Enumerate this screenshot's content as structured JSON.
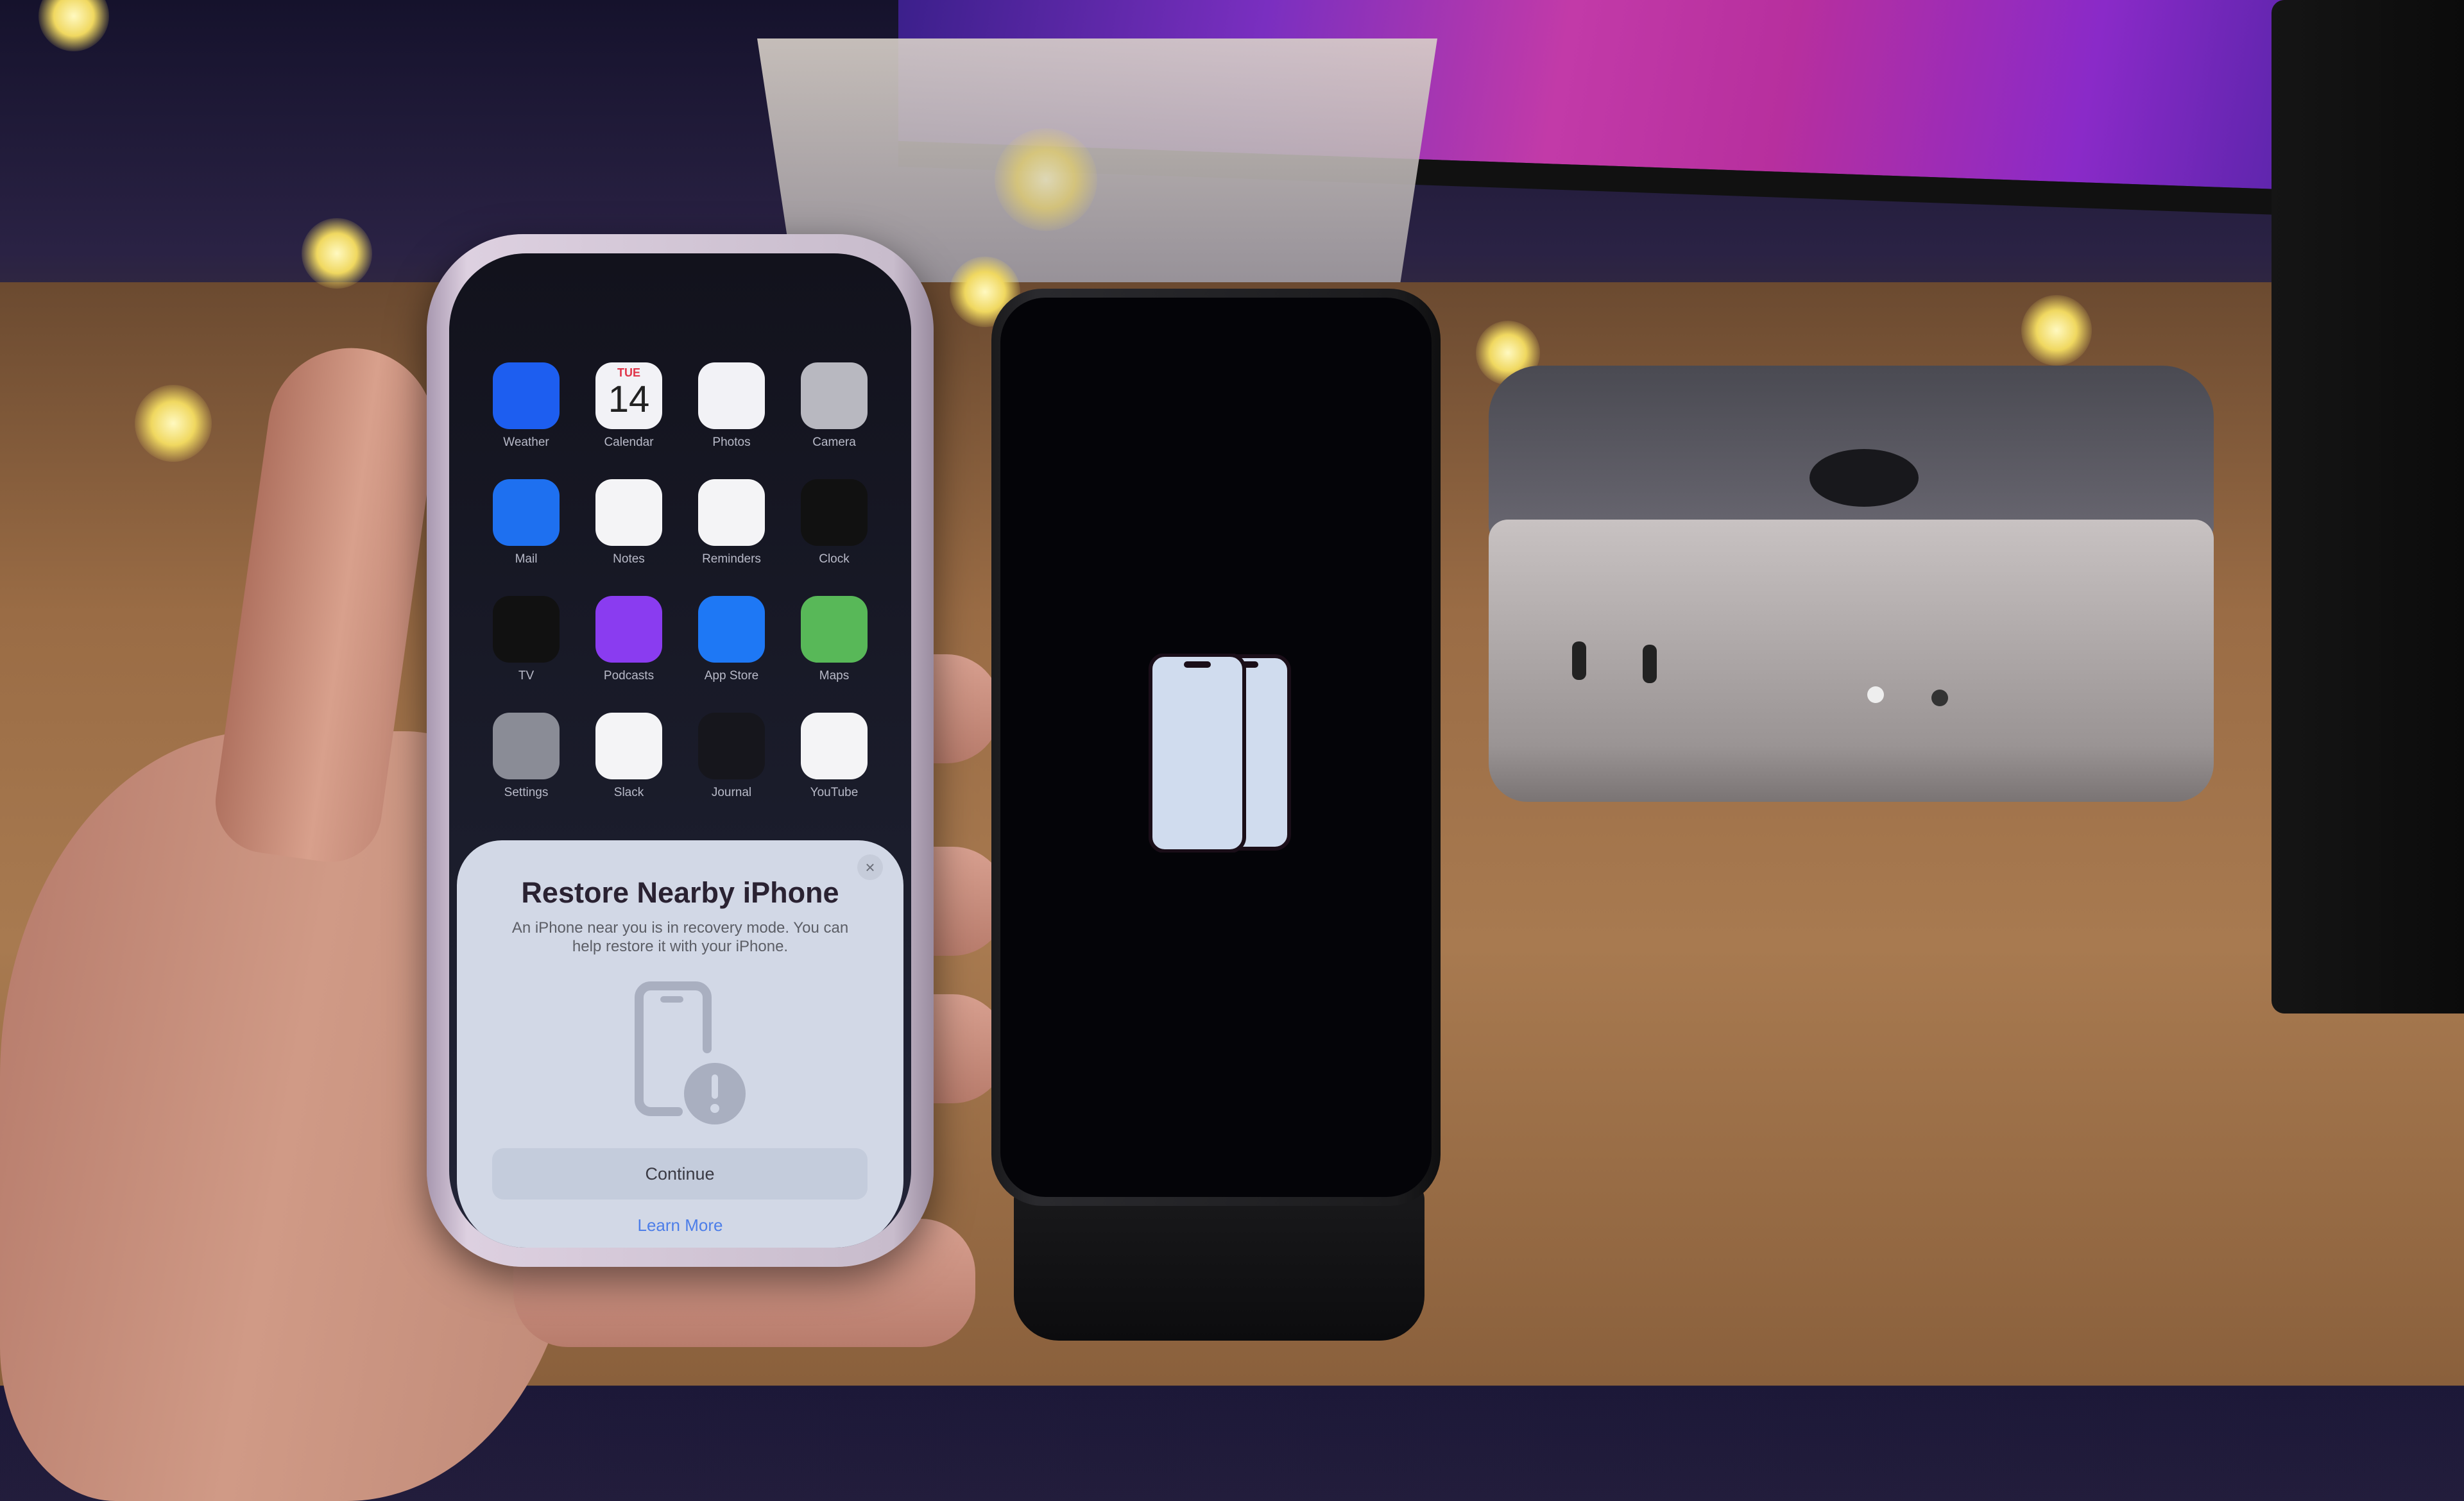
{
  "scene": {
    "description": "Two iPhones on desk; left iPhone shows Restore Nearby iPhone sheet, right iPhone shows recovery mode graphic"
  },
  "home_screen": {
    "apps": [
      {
        "label": "Weather",
        "icon": "weather-icon",
        "color": "#1d5ef0"
      },
      {
        "label": "Calendar",
        "icon": "calendar-icon",
        "color": "#f2f2f6",
        "day": "TUE",
        "date": "14"
      },
      {
        "label": "Photos",
        "icon": "photos-icon",
        "color": "#f2f2f6"
      },
      {
        "label": "Camera",
        "icon": "camera-icon",
        "color": "#b8b8c0"
      },
      {
        "label": "Mail",
        "icon": "mail-icon",
        "color": "#1e70f0"
      },
      {
        "label": "Notes",
        "icon": "notes-icon",
        "color": "#f4f4f6"
      },
      {
        "label": "Reminders",
        "icon": "reminders-icon",
        "color": "#f4f4f6"
      },
      {
        "label": "Clock",
        "icon": "clock-icon",
        "color": "#111111"
      },
      {
        "label": "TV",
        "icon": "apple-tv-icon",
        "color": "#111111"
      },
      {
        "label": "Podcasts",
        "icon": "podcasts-icon",
        "color": "#8a3cf0"
      },
      {
        "label": "App Store",
        "icon": "app-store-icon",
        "color": "#1e78f5"
      },
      {
        "label": "Maps",
        "icon": "maps-icon",
        "color": "#58b858"
      },
      {
        "label": "Settings",
        "icon": "settings-icon",
        "color": "#8a8c96"
      },
      {
        "label": "Slack",
        "icon": "slack-icon",
        "color": "#f4f4f6"
      },
      {
        "label": "Journal",
        "icon": "journal-icon",
        "color": "#16161c"
      },
      {
        "label": "YouTube",
        "icon": "youtube-icon",
        "color": "#f4f4f6"
      }
    ],
    "partial_row_colors": [
      "#e0e0e6",
      "#0c0c10",
      "#3a6ae8",
      "#1a1a1e"
    ]
  },
  "sheet": {
    "title": "Restore Nearby iPhone",
    "body": "An iPhone near you is in recovery mode. You can help restore it with your iPhone.",
    "close_icon": "×",
    "continue_label": "Continue",
    "learn_more_label": "Learn More",
    "accent": "#4d7ee8"
  }
}
